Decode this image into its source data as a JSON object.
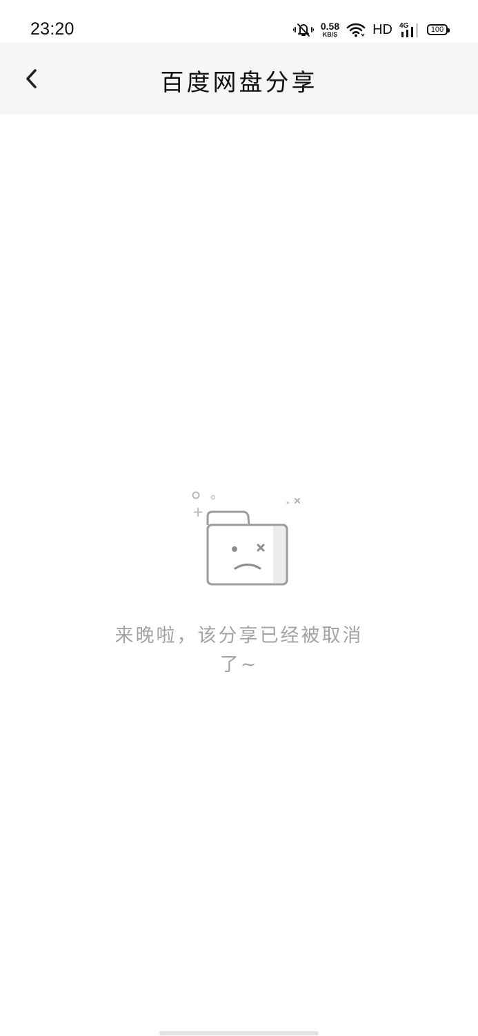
{
  "status_bar": {
    "time": "23:20",
    "net_speed_value": "0.58",
    "net_speed_unit": "KB/S",
    "hd_label": "HD",
    "network_type": "4G",
    "battery_level": "100",
    "icons": [
      "mute-vibrate-icon",
      "wifi-icon",
      "signal-icon",
      "battery-icon"
    ]
  },
  "nav": {
    "title": "百度网盘分享",
    "back_icon": "chevron-left-icon"
  },
  "empty_state": {
    "icon": "sad-folder-icon",
    "message": "来晚啦，该分享已经被取消了~"
  },
  "colors": {
    "nav_background": "#f6f6f6",
    "message_text": "#a3a3a3",
    "illustration_stroke": "#999999"
  }
}
